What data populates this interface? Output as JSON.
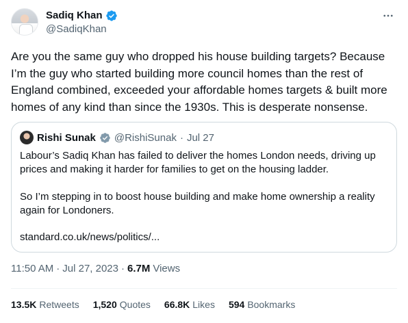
{
  "author": {
    "display_name": "Sadiq Khan",
    "handle": "@SadiqKhan"
  },
  "tweet": {
    "text": "Are you the same guy who dropped his house building targets? Because I’m the guy who started building more council homes than the rest of England combined, exceeded your affordable homes targets & built more homes of any kind than since the 1930s. This is desperate nonsense."
  },
  "quoted": {
    "display_name": "Rishi Sunak",
    "handle": "@RishiSunak",
    "separator": "·",
    "date": "Jul 27",
    "paragraph1": "Labour’s Sadiq Khan has failed to deliver the homes London needs, driving up prices and making it harder for families to get on the housing ladder.",
    "paragraph2": "So I’m stepping in to boost house building and make home ownership a reality again for Londoners.",
    "link": "standard.co.uk/news/politics/..."
  },
  "meta": {
    "time": "11:50 AM",
    "dot": "·",
    "date": "Jul 27, 2023",
    "views_count": "6.7M",
    "views_label": "Views"
  },
  "stats": {
    "retweets_count": "13.5K",
    "retweets_label": "Retweets",
    "quotes_count": "1,520",
    "quotes_label": "Quotes",
    "likes_count": "66.8K",
    "likes_label": "Likes",
    "bookmarks_count": "594",
    "bookmarks_label": "Bookmarks"
  },
  "colors": {
    "verified": "#1d9bf0",
    "text": "#0f1419",
    "secondary": "#536471",
    "border": "#cfd9de"
  }
}
